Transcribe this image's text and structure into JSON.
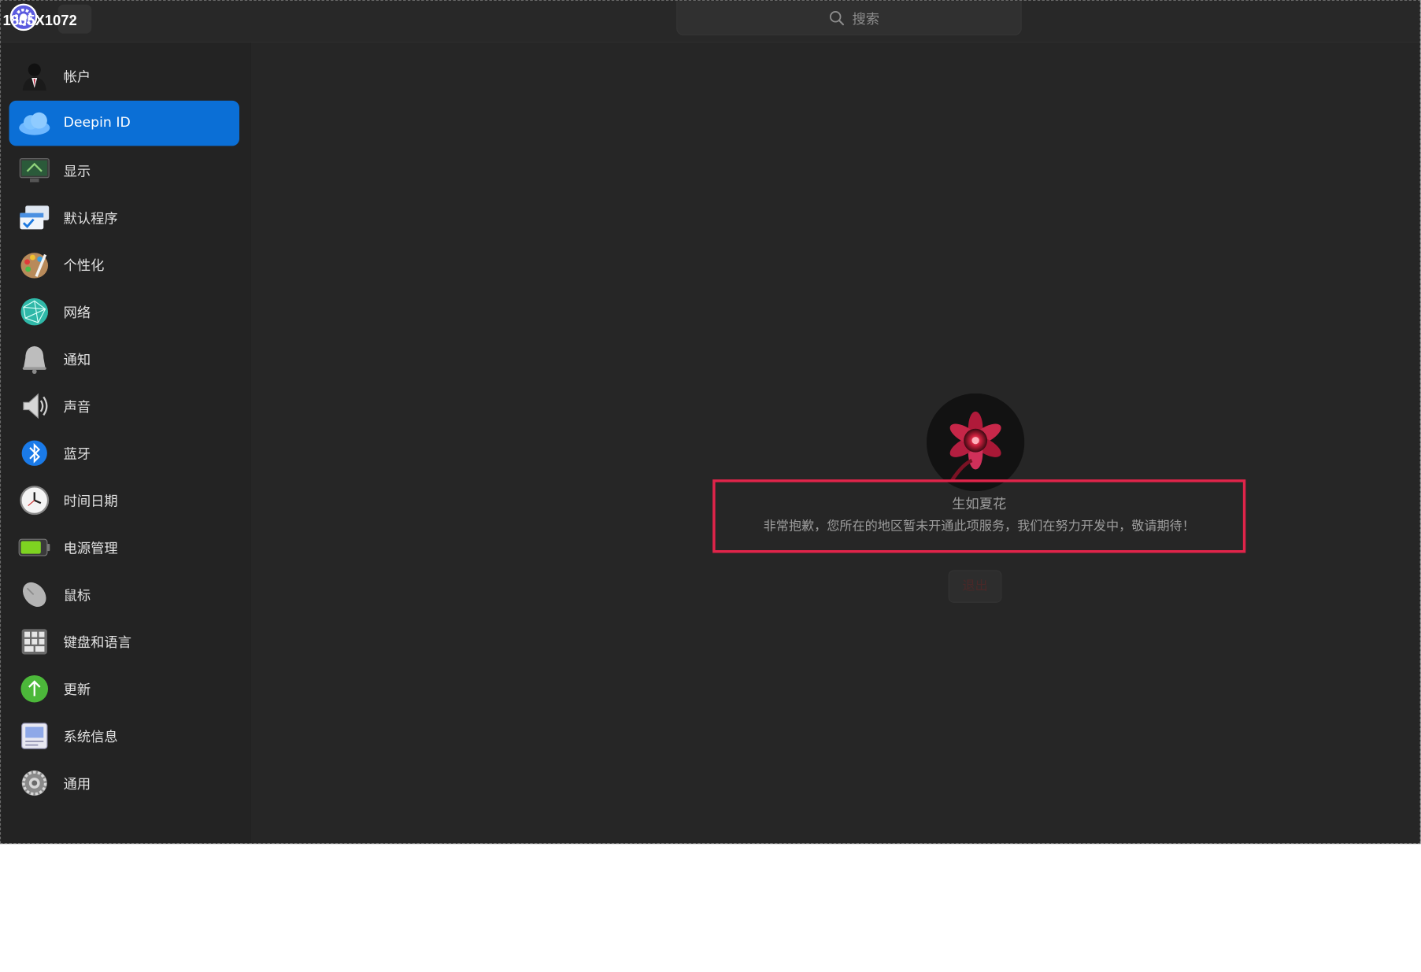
{
  "overlay": {
    "dimension_label": "1805X1072"
  },
  "titlebar": {
    "back_icon": "chevron-left-icon",
    "search_placeholder": "搜索"
  },
  "sidebar": {
    "items": [
      {
        "label": "帐户",
        "icon": "account-icon"
      },
      {
        "label": "Deepin ID",
        "icon": "cloud-icon",
        "active": true
      },
      {
        "label": "显示",
        "icon": "display-icon"
      },
      {
        "label": "默认程序",
        "icon": "default-apps-icon"
      },
      {
        "label": "个性化",
        "icon": "personalization-icon"
      },
      {
        "label": "网络",
        "icon": "network-icon"
      },
      {
        "label": "通知",
        "icon": "bell-icon"
      },
      {
        "label": "声音",
        "icon": "speaker-icon"
      },
      {
        "label": "蓝牙",
        "icon": "bluetooth-icon"
      },
      {
        "label": "时间日期",
        "icon": "clock-icon"
      },
      {
        "label": "电源管理",
        "icon": "battery-icon"
      },
      {
        "label": "鼠标",
        "icon": "mouse-icon"
      },
      {
        "label": "键盘和语言",
        "icon": "keyboard-icon"
      },
      {
        "label": "更新",
        "icon": "update-icon"
      },
      {
        "label": "系统信息",
        "icon": "system-info-icon"
      },
      {
        "label": "通用",
        "icon": "general-settings-icon"
      }
    ]
  },
  "main": {
    "username": "生如夏花",
    "notice": "非常抱歉，您所在的地区暂未开通此项服务，我们在努力开发中，敬请期待！",
    "logout_label": "退出"
  },
  "colors": {
    "accent": "#0b6fd6",
    "highlight_border": "#e0244a",
    "background": "#252525"
  }
}
